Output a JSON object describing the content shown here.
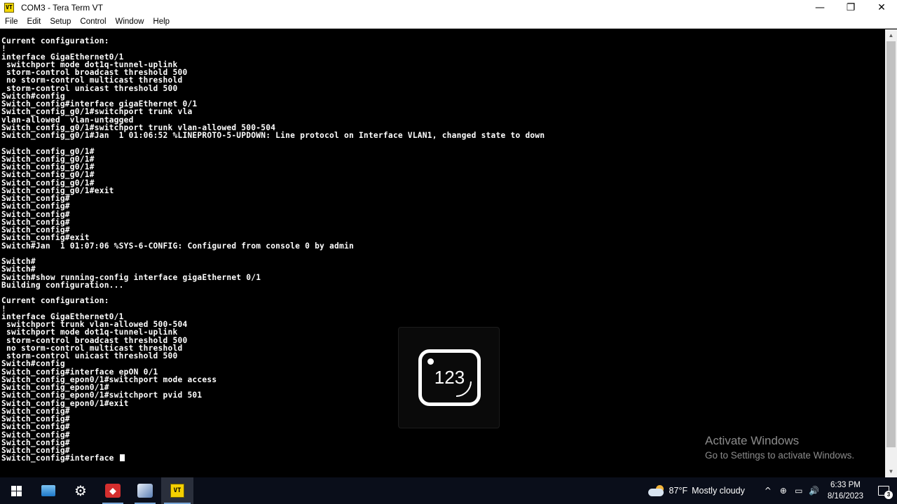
{
  "window": {
    "title": "COM3 - Tera Term VT",
    "app_icon_label": "VT",
    "minimize": "—",
    "maximize": "❐",
    "close": "✕"
  },
  "menu": [
    "File",
    "Edit",
    "Setup",
    "Control",
    "Window",
    "Help"
  ],
  "terminal": {
    "lines": [
      "Current configuration:",
      "!",
      "interface GigaEthernet0/1",
      " switchport mode dot1q-tunnel-uplink",
      " storm-control broadcast threshold 500",
      " no storm-control multicast threshold",
      " storm-control unicast threshold 500",
      "Switch#config",
      "Switch_config#interface gigaEthernet 0/1",
      "Switch_config_g0/1#switchport trunk vla",
      "vlan-allowed  vlan-untagged",
      "Switch_config_g0/1#switchport trunk vlan-allowed 500-504",
      "Switch_config_g0/1#Jan  1 01:06:52 %LINEPROTO-5-UPDOWN: Line protocol on Interface VLAN1, changed state to down",
      "",
      "Switch_config_g0/1#",
      "Switch_config_g0/1#",
      "Switch_config_g0/1#",
      "Switch_config_g0/1#",
      "Switch_config_g0/1#",
      "Switch_config_g0/1#exit",
      "Switch_config#",
      "Switch_config#",
      "Switch_config#",
      "Switch_config#",
      "Switch_config#",
      "Switch_config#exit",
      "Switch#Jan  1 01:07:06 %SYS-6-CONFIG: Configured from console 0 by admin",
      "",
      "Switch#",
      "Switch#",
      "Switch#show running-config interface gigaEthernet 0/1",
      "Building configuration...",
      "",
      "Current configuration:",
      "!",
      "interface GigaEthernet0/1",
      " switchport trunk vlan-allowed 500-504",
      " switchport mode dot1q-tunnel-uplink",
      " storm-control broadcast threshold 500",
      " no storm-control multicast threshold",
      " storm-control unicast threshold 500",
      "Switch#config",
      "Switch_config#interface epON 0/1",
      "Switch_config_epon0/1#switchport mode access",
      "Switch_config_epon0/1#",
      "Switch_config_epon0/1#switchport pvid 501",
      "Switch_config_epon0/1#exit",
      "Switch_config#",
      "Switch_config#",
      "Switch_config#",
      "Switch_config#",
      "Switch_config#",
      "Switch_config#",
      "Switch_config#interface "
    ]
  },
  "overlay": {
    "number": "123"
  },
  "watermark": {
    "title": "Activate Windows",
    "subtitle": "Go to Settings to activate Windows."
  },
  "taskbar": {
    "apps": [
      {
        "name": "start",
        "icon": "windows-icon"
      },
      {
        "name": "file-explorer",
        "icon": "folder-icon"
      },
      {
        "name": "settings",
        "icon": "gear-icon"
      },
      {
        "name": "app-red",
        "icon": "red-app-icon"
      },
      {
        "name": "network-app",
        "icon": "network-icon"
      },
      {
        "name": "tera-term",
        "icon": "teraterm-icon",
        "label": "VT"
      }
    ],
    "weather": {
      "temp": "87°F",
      "condition": "Mostly cloudy"
    },
    "tray_icons": [
      "^",
      "⊕",
      "▭",
      "🔊"
    ],
    "time": "6:33 PM",
    "date": "8/16/2023",
    "notification_count": "3"
  }
}
